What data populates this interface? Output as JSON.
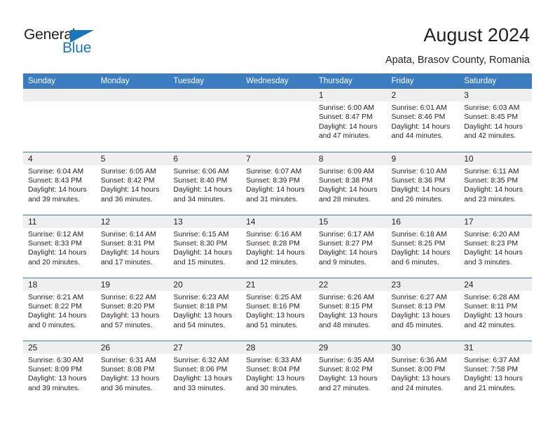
{
  "brand": {
    "name_part1": "General",
    "name_part2": "Blue",
    "triangle_color": "#1b75bb"
  },
  "header": {
    "title": "August 2024",
    "subtitle": "Apata, Brasov County, Romania",
    "accent_color": "#3b7dc0",
    "daynum_band_color": "#efefef"
  },
  "calendar": {
    "weekday_headers": [
      "Sunday",
      "Monday",
      "Tuesday",
      "Wednesday",
      "Thursday",
      "Friday",
      "Saturday"
    ],
    "weeks": [
      [
        {
          "day": "",
          "lines": []
        },
        {
          "day": "",
          "lines": []
        },
        {
          "day": "",
          "lines": []
        },
        {
          "day": "",
          "lines": []
        },
        {
          "day": "1",
          "lines": [
            "Sunrise: 6:00 AM",
            "Sunset: 8:47 PM",
            "Daylight: 14 hours",
            "and 47 minutes."
          ]
        },
        {
          "day": "2",
          "lines": [
            "Sunrise: 6:01 AM",
            "Sunset: 8:46 PM",
            "Daylight: 14 hours",
            "and 44 minutes."
          ]
        },
        {
          "day": "3",
          "lines": [
            "Sunrise: 6:03 AM",
            "Sunset: 8:45 PM",
            "Daylight: 14 hours",
            "and 42 minutes."
          ]
        }
      ],
      [
        {
          "day": "4",
          "lines": [
            "Sunrise: 6:04 AM",
            "Sunset: 8:43 PM",
            "Daylight: 14 hours",
            "and 39 minutes."
          ]
        },
        {
          "day": "5",
          "lines": [
            "Sunrise: 6:05 AM",
            "Sunset: 8:42 PM",
            "Daylight: 14 hours",
            "and 36 minutes."
          ]
        },
        {
          "day": "6",
          "lines": [
            "Sunrise: 6:06 AM",
            "Sunset: 8:40 PM",
            "Daylight: 14 hours",
            "and 34 minutes."
          ]
        },
        {
          "day": "7",
          "lines": [
            "Sunrise: 6:07 AM",
            "Sunset: 8:39 PM",
            "Daylight: 14 hours",
            "and 31 minutes."
          ]
        },
        {
          "day": "8",
          "lines": [
            "Sunrise: 6:09 AM",
            "Sunset: 8:38 PM",
            "Daylight: 14 hours",
            "and 28 minutes."
          ]
        },
        {
          "day": "9",
          "lines": [
            "Sunrise: 6:10 AM",
            "Sunset: 8:36 PM",
            "Daylight: 14 hours",
            "and 26 minutes."
          ]
        },
        {
          "day": "10",
          "lines": [
            "Sunrise: 6:11 AM",
            "Sunset: 8:35 PM",
            "Daylight: 14 hours",
            "and 23 minutes."
          ]
        }
      ],
      [
        {
          "day": "11",
          "lines": [
            "Sunrise: 6:12 AM",
            "Sunset: 8:33 PM",
            "Daylight: 14 hours",
            "and 20 minutes."
          ]
        },
        {
          "day": "12",
          "lines": [
            "Sunrise: 6:14 AM",
            "Sunset: 8:31 PM",
            "Daylight: 14 hours",
            "and 17 minutes."
          ]
        },
        {
          "day": "13",
          "lines": [
            "Sunrise: 6:15 AM",
            "Sunset: 8:30 PM",
            "Daylight: 14 hours",
            "and 15 minutes."
          ]
        },
        {
          "day": "14",
          "lines": [
            "Sunrise: 6:16 AM",
            "Sunset: 8:28 PM",
            "Daylight: 14 hours",
            "and 12 minutes."
          ]
        },
        {
          "day": "15",
          "lines": [
            "Sunrise: 6:17 AM",
            "Sunset: 8:27 PM",
            "Daylight: 14 hours",
            "and 9 minutes."
          ]
        },
        {
          "day": "16",
          "lines": [
            "Sunrise: 6:18 AM",
            "Sunset: 8:25 PM",
            "Daylight: 14 hours",
            "and 6 minutes."
          ]
        },
        {
          "day": "17",
          "lines": [
            "Sunrise: 6:20 AM",
            "Sunset: 8:23 PM",
            "Daylight: 14 hours",
            "and 3 minutes."
          ]
        }
      ],
      [
        {
          "day": "18",
          "lines": [
            "Sunrise: 6:21 AM",
            "Sunset: 8:22 PM",
            "Daylight: 14 hours",
            "and 0 minutes."
          ]
        },
        {
          "day": "19",
          "lines": [
            "Sunrise: 6:22 AM",
            "Sunset: 8:20 PM",
            "Daylight: 13 hours",
            "and 57 minutes."
          ]
        },
        {
          "day": "20",
          "lines": [
            "Sunrise: 6:23 AM",
            "Sunset: 8:18 PM",
            "Daylight: 13 hours",
            "and 54 minutes."
          ]
        },
        {
          "day": "21",
          "lines": [
            "Sunrise: 6:25 AM",
            "Sunset: 8:16 PM",
            "Daylight: 13 hours",
            "and 51 minutes."
          ]
        },
        {
          "day": "22",
          "lines": [
            "Sunrise: 6:26 AM",
            "Sunset: 8:15 PM",
            "Daylight: 13 hours",
            "and 48 minutes."
          ]
        },
        {
          "day": "23",
          "lines": [
            "Sunrise: 6:27 AM",
            "Sunset: 8:13 PM",
            "Daylight: 13 hours",
            "and 45 minutes."
          ]
        },
        {
          "day": "24",
          "lines": [
            "Sunrise: 6:28 AM",
            "Sunset: 8:11 PM",
            "Daylight: 13 hours",
            "and 42 minutes."
          ]
        }
      ],
      [
        {
          "day": "25",
          "lines": [
            "Sunrise: 6:30 AM",
            "Sunset: 8:09 PM",
            "Daylight: 13 hours",
            "and 39 minutes."
          ]
        },
        {
          "day": "26",
          "lines": [
            "Sunrise: 6:31 AM",
            "Sunset: 8:08 PM",
            "Daylight: 13 hours",
            "and 36 minutes."
          ]
        },
        {
          "day": "27",
          "lines": [
            "Sunrise: 6:32 AM",
            "Sunset: 8:06 PM",
            "Daylight: 13 hours",
            "and 33 minutes."
          ]
        },
        {
          "day": "28",
          "lines": [
            "Sunrise: 6:33 AM",
            "Sunset: 8:04 PM",
            "Daylight: 13 hours",
            "and 30 minutes."
          ]
        },
        {
          "day": "29",
          "lines": [
            "Sunrise: 6:35 AM",
            "Sunset: 8:02 PM",
            "Daylight: 13 hours",
            "and 27 minutes."
          ]
        },
        {
          "day": "30",
          "lines": [
            "Sunrise: 6:36 AM",
            "Sunset: 8:00 PM",
            "Daylight: 13 hours",
            "and 24 minutes."
          ]
        },
        {
          "day": "31",
          "lines": [
            "Sunrise: 6:37 AM",
            "Sunset: 7:58 PM",
            "Daylight: 13 hours",
            "and 21 minutes."
          ]
        }
      ]
    ]
  }
}
